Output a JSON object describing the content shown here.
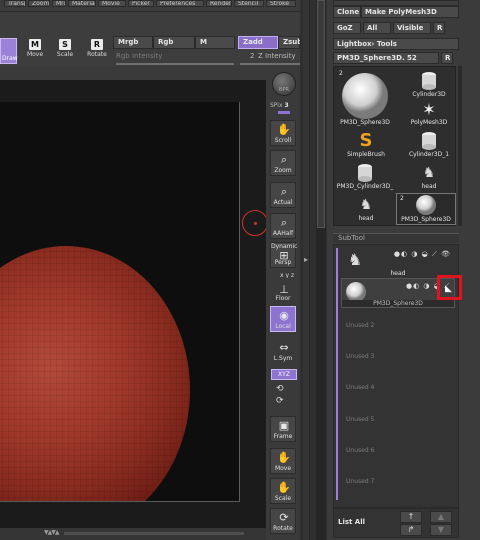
{
  "top_menu": [
    "Transp",
    "Zoom",
    "Mrgb",
    "Material",
    "Movie",
    "Picker",
    "Preferences",
    "Render",
    "Stencil",
    "Stroke"
  ],
  "toolbar": {
    "draw_label": "Draw",
    "move": {
      "key": "M",
      "label": "Move"
    },
    "scale": {
      "key": "S",
      "label": "Scale"
    },
    "rotate": {
      "key": "R",
      "label": "Rotate"
    },
    "mrgb": "Mrgb",
    "rgb": "Rgb",
    "m": "M",
    "zadd": "Zadd",
    "zsub": "Zsub",
    "rgb_intensity": "Rgb Intensity",
    "z_intensity": "Z Intensity",
    "z_intensity_value": "2"
  },
  "shelf": {
    "bpr": "BPR",
    "spix_label": "SPix",
    "spix_value": "3",
    "scroll": "Scroll",
    "zoom": "Zoom",
    "actual": "Actual",
    "aahalf": "AAHalf",
    "dynamic": "Dynamic",
    "persp": "Persp",
    "floor": "Floor",
    "local": "Local",
    "lsym": "L.Sym",
    "xyz": "XYZ",
    "frame": "Frame",
    "move": "Move",
    "scale": "Scale",
    "rotate": "Rotate"
  },
  "tool_panel": {
    "clone": "Clone",
    "make_polymesh": "Make PolyMesh3D",
    "goz": "GoZ",
    "all": "All",
    "visible": "Visible",
    "r": "R",
    "lightbox_tools": "Lightbox› Tools",
    "current_tool": "PM3D_Sphere3D. 52",
    "current_r": "R",
    "tools": [
      {
        "name": "PM3D_Sphere3D",
        "badge": "2"
      },
      {
        "name": "Cylinder3D",
        "badge": ""
      },
      {
        "name": "PolyMesh3D",
        "badge": ""
      },
      {
        "name": "SimpleBrush",
        "badge": ""
      },
      {
        "name": "Cylinder3D_1",
        "badge": ""
      },
      {
        "name": "PM3D_Cylinder3D_",
        "badge": ""
      },
      {
        "name": "head",
        "badge": ""
      },
      {
        "name": "head",
        "badge": ""
      },
      {
        "name": "PM3D_Sphere3D",
        "badge": "2"
      }
    ]
  },
  "subtool": {
    "header": "SubTool",
    "items": [
      {
        "name": "head",
        "active": false
      },
      {
        "name": "PM3D_Sphere3D",
        "active": true
      }
    ],
    "unused": [
      "Unused 2",
      "Unused 3",
      "Unused 4",
      "Unused 5",
      "Unused 6",
      "Unused 7"
    ],
    "list_all": "List All"
  },
  "colors": {
    "accent": "#8c74d0",
    "highlight": "#e0141c",
    "sphere": "#a23a2c"
  }
}
